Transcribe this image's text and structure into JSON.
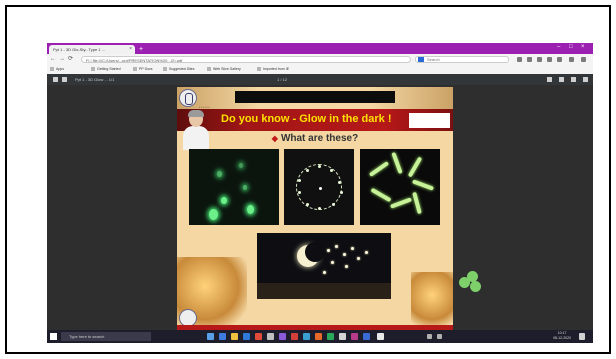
{
  "browser": {
    "tab_title": "Ppt 1 - 3D Glo-Sty...Type 1 ...",
    "tab_close": "×",
    "new_tab": "+",
    "window_controls": {
      "minimize": "–",
      "maximize": "□",
      "close": "×"
    },
    "nav": {
      "back": "←",
      "forward": "→",
      "reload": "⟳"
    },
    "address": "Fi | file:///C:/Users/...ppt/PRESENTATION%20...(2).pdf",
    "search_placeholder": "Search",
    "bookmarks": [
      "Apps",
      "Getting Started",
      "PP Docs",
      "Suggested Sites",
      "Web Slice Gallery",
      "Imported from IE"
    ]
  },
  "pdf_viewer": {
    "title": "Ppt 1 - 3D Glow ... 1/1",
    "page_indicator": "1 / 12"
  },
  "slide": {
    "heading": "Do you know - Glow in the dark !",
    "question": "What are these?",
    "header_caption": "• • • • • •"
  },
  "taskbar": {
    "search_placeholder": "Type here to search",
    "time": "10:17",
    "date": "08-12-2020"
  },
  "colors": {
    "tab_strip": "#9b1fb0",
    "title_bar": "#b71818",
    "title_text": "#ffe200",
    "slide_bg": "#f4d7a3",
    "glow_green": "#6df08a"
  }
}
